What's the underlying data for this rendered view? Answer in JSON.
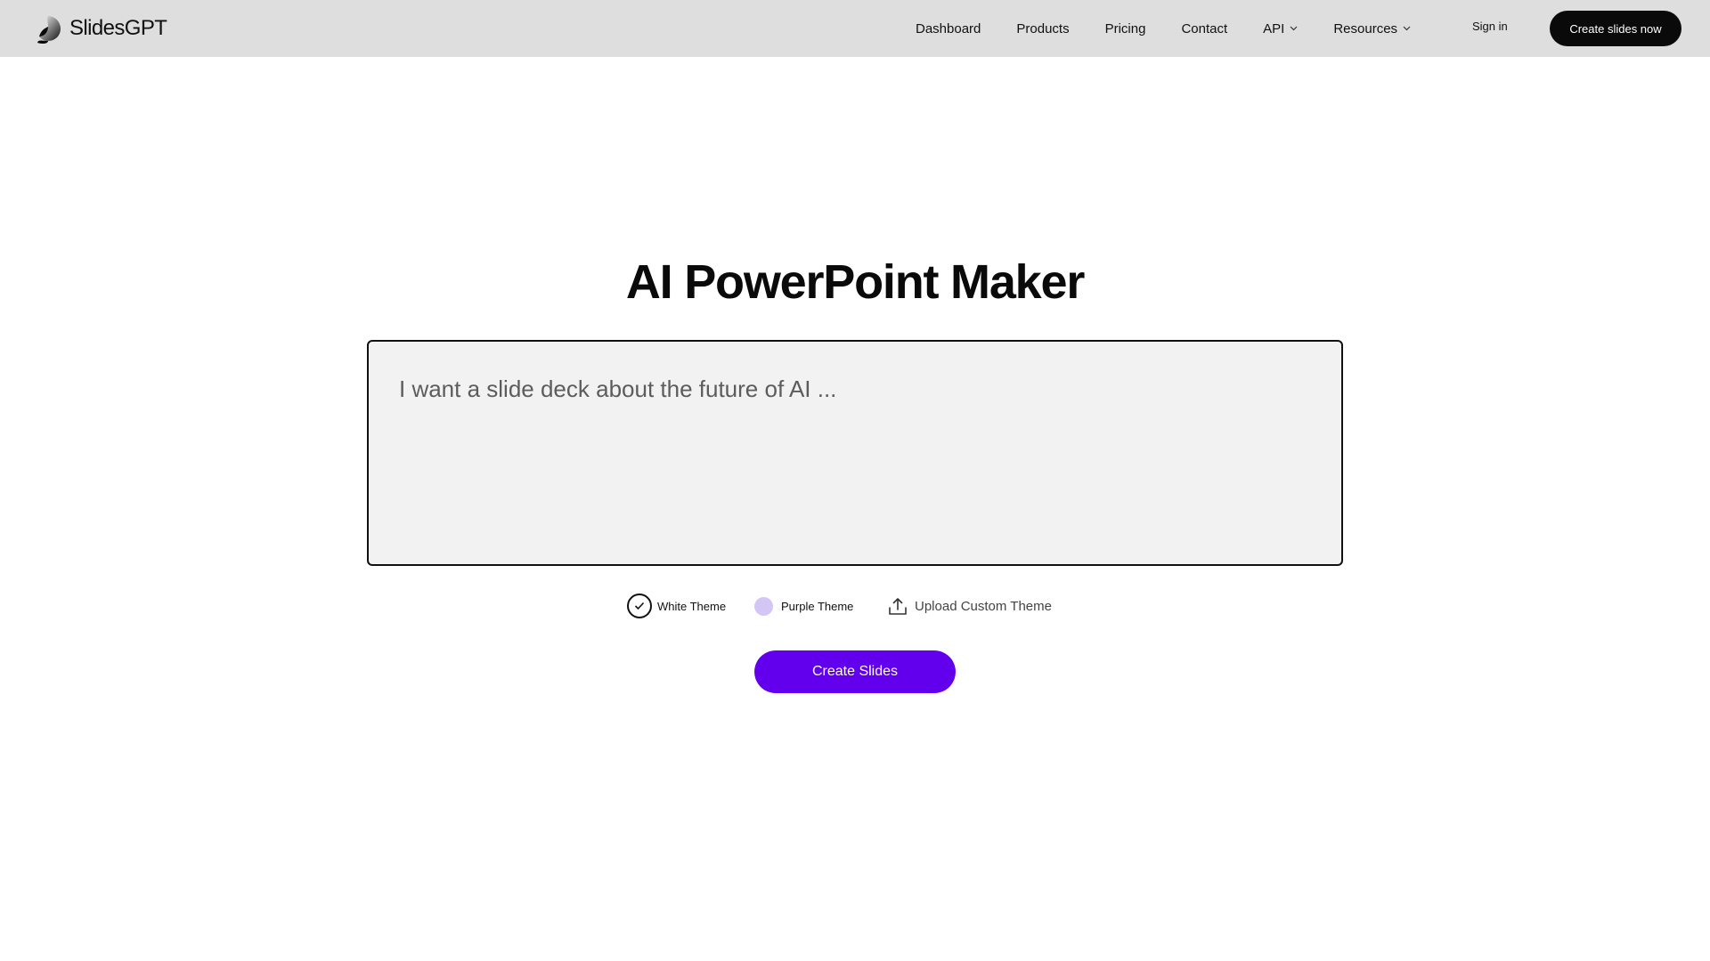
{
  "header": {
    "brand": "SlidesGPT",
    "nav": [
      {
        "label": "Dashboard",
        "has_dropdown": false
      },
      {
        "label": "Products",
        "has_dropdown": false
      },
      {
        "label": "Pricing",
        "has_dropdown": false
      },
      {
        "label": "Contact",
        "has_dropdown": false
      },
      {
        "label": "API",
        "has_dropdown": true
      },
      {
        "label": "Resources",
        "has_dropdown": true
      }
    ],
    "sign_in": "Sign in",
    "cta": "Create slides now"
  },
  "main": {
    "title": "AI PowerPoint Maker",
    "prompt": {
      "value": "",
      "placeholder": "I want a slide deck about the future of AI ..."
    },
    "themes": [
      {
        "label": "White Theme",
        "selected": true,
        "icon": "check-icon"
      },
      {
        "label": "Purple Theme",
        "selected": false,
        "icon": "purple-swatch"
      }
    ],
    "upload_theme": {
      "label": "Upload Custom Theme",
      "icon": "upload-icon"
    },
    "create_button": "Create Slides"
  },
  "colors": {
    "header_bg": "#dedede",
    "primary": "#6200ee",
    "purple_swatch": "#d3c6f7",
    "cta_bg": "#0a0a0a",
    "textarea_bg": "#f2f2f2"
  }
}
